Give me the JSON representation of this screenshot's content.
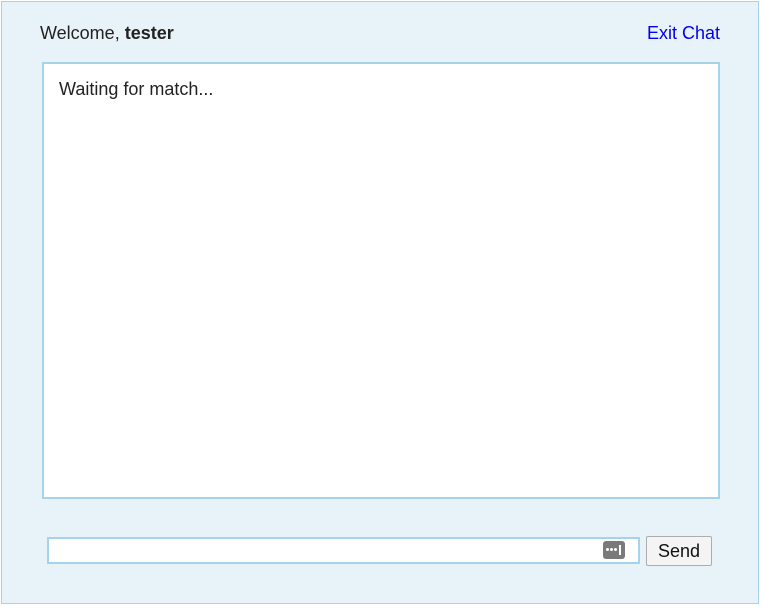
{
  "header": {
    "welcome_prefix": "Welcome,",
    "username": "tester",
    "exit_label": "Exit Chat"
  },
  "chat": {
    "status_message": "Waiting for match..."
  },
  "composer": {
    "message_value": "",
    "send_label": "Send",
    "password_manager_icon": "password-dots-icon"
  },
  "colors": {
    "panel_background": "#e8f2f9",
    "border": "#a5d3eb",
    "link": "#0000ee"
  }
}
